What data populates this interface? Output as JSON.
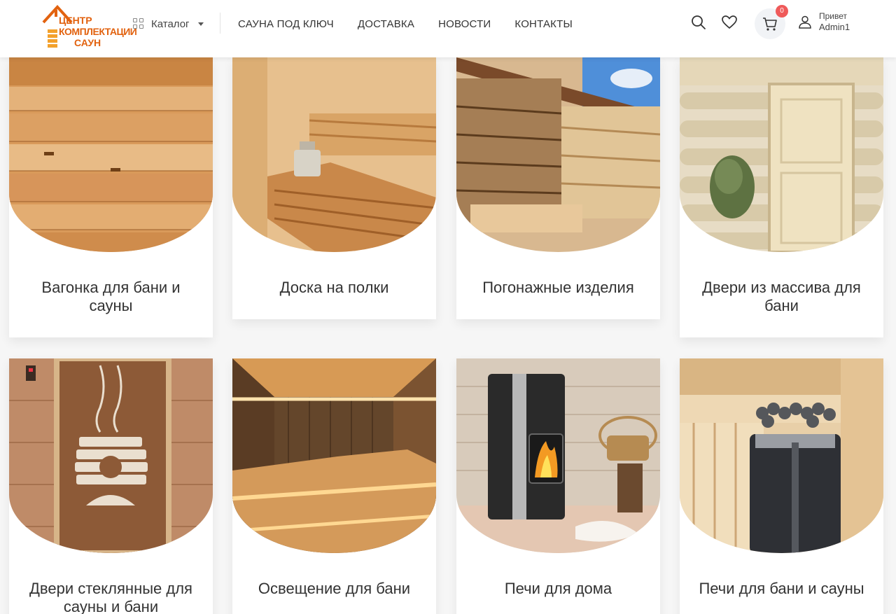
{
  "logo": {
    "line1": "ЦЕНТР",
    "line2": "КОМПЛЕКТАЦИИ",
    "line3": "САУН",
    "color": "#e2620f"
  },
  "header": {
    "catalog_label": "Каталог",
    "nav": [
      "САУНА ПОД КЛЮЧ",
      "ДОСТАВКА",
      "НОВОСТИ",
      "КОНТАКТЫ"
    ],
    "cart_count": "0",
    "greeting": "Привет",
    "username": "Admin1",
    "badge_color": "#ef5a5a"
  },
  "categories": [
    {
      "title": "Вагонка для бани и сауны",
      "image": "lining-boards"
    },
    {
      "title": "Доска на полки",
      "image": "sauna-benches"
    },
    {
      "title": "Погонажные изделия",
      "image": "lumber-stacks"
    },
    {
      "title": "Двери из массива для бани",
      "image": "wooden-door"
    },
    {
      "title": "Двери стеклянные для сауны и бани",
      "image": "glass-door"
    },
    {
      "title": "Освещение для бани",
      "image": "sauna-lighting"
    },
    {
      "title": "Печи для дома",
      "image": "home-stove"
    },
    {
      "title": "Печи для бани и сауны",
      "image": "sauna-heater"
    }
  ]
}
